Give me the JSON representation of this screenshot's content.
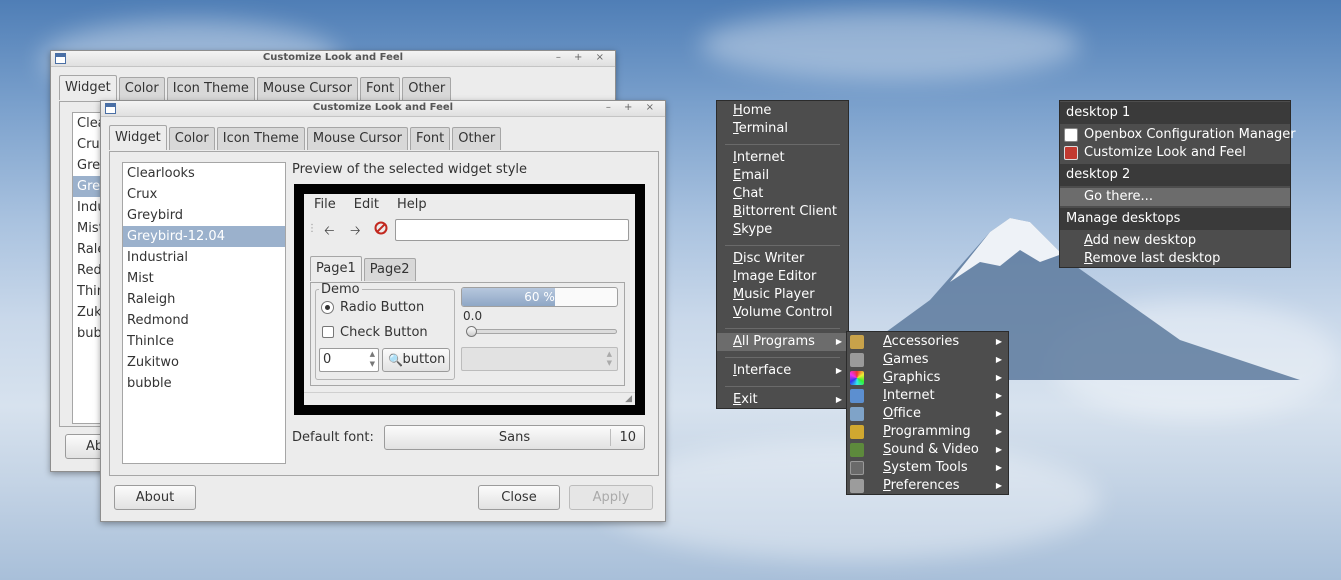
{
  "back_window": {
    "title": "Customize Look and Feel",
    "tabs": [
      "Widget",
      "Color",
      "Icon Theme",
      "Mouse Cursor",
      "Font",
      "Other"
    ],
    "list_partial": [
      "Clea",
      "Crux",
      "Grey",
      "Grey",
      "Indu",
      "Mist",
      "Rale",
      "Red",
      "Thin",
      "Zuki",
      "bubb"
    ],
    "about_partial": "Ab"
  },
  "front_window": {
    "title": "Customize Look and Feel",
    "tabs": [
      "Widget",
      "Color",
      "Icon Theme",
      "Mouse Cursor",
      "Font",
      "Other"
    ],
    "themes": [
      "Clearlooks",
      "Crux",
      "Greybird",
      "Greybird-12.04",
      "Industrial",
      "Mist",
      "Raleigh",
      "Redmond",
      "ThinIce",
      "Zukitwo",
      "bubble"
    ],
    "selected_theme": "Greybird-12.04",
    "preview_label": "Preview of the selected widget style",
    "preview": {
      "menus": [
        "File",
        "Edit",
        "Help"
      ],
      "tabs": [
        "Page1",
        "Page2"
      ],
      "frame_label": "Demo",
      "radio_label": "Radio Button",
      "check_label": "Check Button",
      "spin_value": "0",
      "button_label": "button",
      "progress_text": "60 %",
      "progress_fraction": 0.6,
      "scale_value": "0.0"
    },
    "default_font_label": "Default font:",
    "font_name": "Sans",
    "font_size": "10",
    "about_label": "About",
    "close_label": "Close",
    "apply_label": "Apply"
  },
  "main_menu": {
    "group1": [
      {
        "label": "Home",
        "ul": "H",
        "rest": "ome"
      },
      {
        "label": "Terminal",
        "ul": "T",
        "rest": "erminal"
      }
    ],
    "group2": [
      {
        "label": "Internet",
        "ul": "I",
        "rest": "nternet"
      },
      {
        "label": "Email",
        "ul": "E",
        "rest": "mail"
      },
      {
        "label": "Chat",
        "ul": "C",
        "rest": "hat"
      },
      {
        "label": "Bittorrent Client",
        "ul": "B",
        "rest": "ittorrent Client"
      },
      {
        "label": "Skype",
        "ul": "S",
        "rest": "kype"
      }
    ],
    "group3": [
      {
        "label": "Disc Writer",
        "ul": "D",
        "rest": "isc Writer"
      },
      {
        "label": "Image Editor",
        "ul": "I",
        "rest": "mage Editor"
      },
      {
        "label": "Music Player",
        "ul": "M",
        "rest": "usic Player"
      },
      {
        "label": "Volume Control",
        "ul": "V",
        "rest": "olume Control"
      }
    ],
    "all_programs": {
      "ul": "A",
      "rest": "ll Programs"
    },
    "interface": {
      "ul": "I",
      "rest": "nterface"
    },
    "exit": {
      "ul": "E",
      "rest": "xit"
    }
  },
  "programs_menu": [
    {
      "label": "Accessories",
      "ul": "A",
      "rest": "ccessories",
      "icon": "accessories-icon",
      "color": "#c8a24a"
    },
    {
      "label": "Games",
      "ul": "G",
      "rest": "ames",
      "icon": "games-icon",
      "color": "#9a9a9a"
    },
    {
      "label": "Graphics",
      "ul": "G",
      "rest": "raphics",
      "icon": "graphics-icon",
      "color": "#d8443c"
    },
    {
      "label": "Internet",
      "ul": "I",
      "rest": "nternet",
      "icon": "internet-icon",
      "color": "#5c8fd0"
    },
    {
      "label": "Office",
      "ul": "O",
      "rest": "ffice",
      "icon": "office-icon",
      "color": "#7fa3c8"
    },
    {
      "label": "Programming",
      "ul": "P",
      "rest": "rogramming",
      "icon": "programming-icon",
      "color": "#d0a830"
    },
    {
      "label": "Sound & Video",
      "ul": "S",
      "rest": "ound & Video",
      "icon": "sound-video-icon",
      "color": "#5d8a3c"
    },
    {
      "label": "System Tools",
      "ul": "S",
      "rest": "ystem Tools",
      "icon": "system-tools-icon",
      "color": "#6a6a6a"
    },
    {
      "label": "Preferences",
      "ul": "P",
      "rest": "references",
      "icon": "preferences-icon",
      "color": "#9c9c9c"
    }
  ],
  "desktop_menu": {
    "desktop1_header": "desktop 1",
    "desktop1_items": [
      "Openbox Configuration Manager",
      "Customize Look and Feel"
    ],
    "desktop2_header": "desktop 2",
    "go_there": "Go there...",
    "manage_header": "Manage desktops",
    "add_desktop": {
      "ul": "A",
      "rest": "dd new desktop"
    },
    "remove_desktop": {
      "ul": "R",
      "rest": "emove last desktop"
    }
  }
}
